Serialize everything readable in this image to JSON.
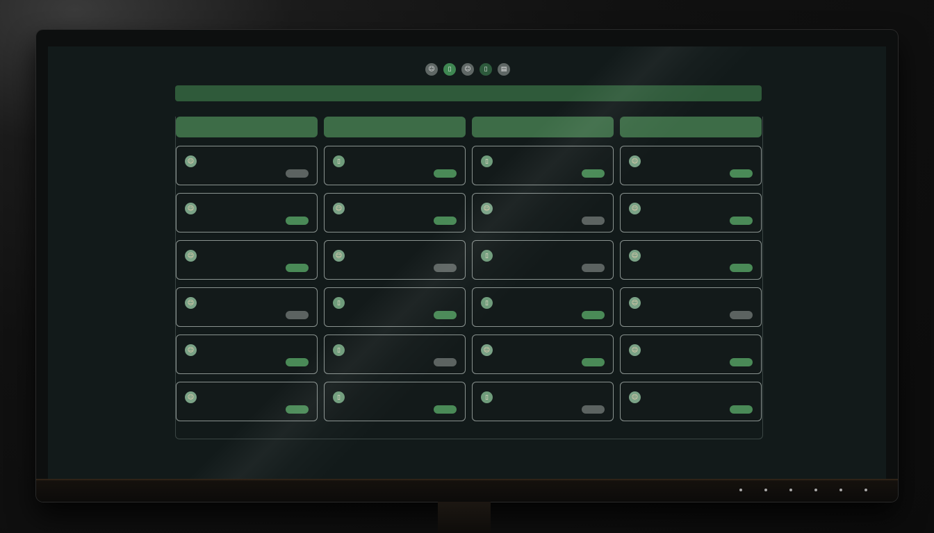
{
  "toolbar": {
    "icons": [
      {
        "name": "user-avatar-icon",
        "glyph": "☺",
        "tone": "grey"
      },
      {
        "name": "document-icon",
        "glyph": "▯",
        "tone": "green"
      },
      {
        "name": "profile-icon",
        "glyph": "☺",
        "tone": "grey"
      },
      {
        "name": "note-icon",
        "glyph": "▯",
        "tone": "dark"
      },
      {
        "name": "list-icon",
        "glyph": "▤",
        "tone": "grey"
      }
    ]
  },
  "banner": {
    "title": ""
  },
  "columns": [
    {
      "title": "",
      "cards": [
        {
          "avatar": "person",
          "name": "",
          "sub": "",
          "badge": "",
          "status": "grey"
        },
        {
          "avatar": "person",
          "name": "",
          "sub": "",
          "badge": "",
          "status": "green"
        },
        {
          "avatar": "person",
          "name": "",
          "sub": "",
          "badge": "",
          "status": "green"
        },
        {
          "avatar": "person",
          "name": "",
          "sub": "",
          "badge": "",
          "status": "grey"
        },
        {
          "avatar": "person",
          "name": "",
          "sub": "",
          "badge": "",
          "status": "green"
        },
        {
          "avatar": "person",
          "name": "",
          "sub": "",
          "badge": "",
          "status": "green"
        }
      ]
    },
    {
      "title": "",
      "cards": [
        {
          "avatar": "doc",
          "name": "",
          "sub": "",
          "badge": "",
          "status": "green"
        },
        {
          "avatar": "person",
          "name": "",
          "sub": "",
          "badge": "",
          "status": "green"
        },
        {
          "avatar": "person",
          "name": "",
          "sub": "",
          "badge": "",
          "status": "grey"
        },
        {
          "avatar": "doc",
          "name": "",
          "sub": "",
          "badge": "",
          "status": "green"
        },
        {
          "avatar": "doc",
          "name": "",
          "sub": "",
          "badge": "",
          "status": "grey"
        },
        {
          "avatar": "doc",
          "name": "",
          "sub": "",
          "badge": "",
          "status": "green"
        }
      ]
    },
    {
      "title": "",
      "cards": [
        {
          "avatar": "doc",
          "name": "",
          "sub": "",
          "badge": "",
          "status": "green"
        },
        {
          "avatar": "person",
          "name": "",
          "sub": "",
          "badge": "",
          "status": "grey"
        },
        {
          "avatar": "doc",
          "name": "",
          "sub": "",
          "badge": "",
          "status": "grey"
        },
        {
          "avatar": "doc",
          "name": "",
          "sub": "",
          "badge": "",
          "status": "green"
        },
        {
          "avatar": "person",
          "name": "",
          "sub": "",
          "badge": "",
          "status": "green"
        },
        {
          "avatar": "doc",
          "name": "",
          "sub": "",
          "badge": "",
          "status": "grey"
        }
      ]
    },
    {
      "title": "",
      "cards": [
        {
          "avatar": "person",
          "name": "",
          "sub": "",
          "badge": "",
          "status": "green"
        },
        {
          "avatar": "person",
          "name": "",
          "sub": "",
          "badge": "",
          "status": "green"
        },
        {
          "avatar": "person",
          "name": "",
          "sub": "",
          "badge": "",
          "status": "green"
        },
        {
          "avatar": "person",
          "name": "",
          "sub": "",
          "badge": "",
          "status": "grey"
        },
        {
          "avatar": "person",
          "name": "",
          "sub": "",
          "badge": "",
          "status": "green"
        },
        {
          "avatar": "person",
          "name": "",
          "sub": "",
          "badge": "",
          "status": "green"
        }
      ]
    }
  ],
  "colors": {
    "accent_green": "#3d6c47",
    "badge_green": "#4a8a57",
    "badge_grey": "#5c6361",
    "screen_bg": "#121a1a"
  }
}
